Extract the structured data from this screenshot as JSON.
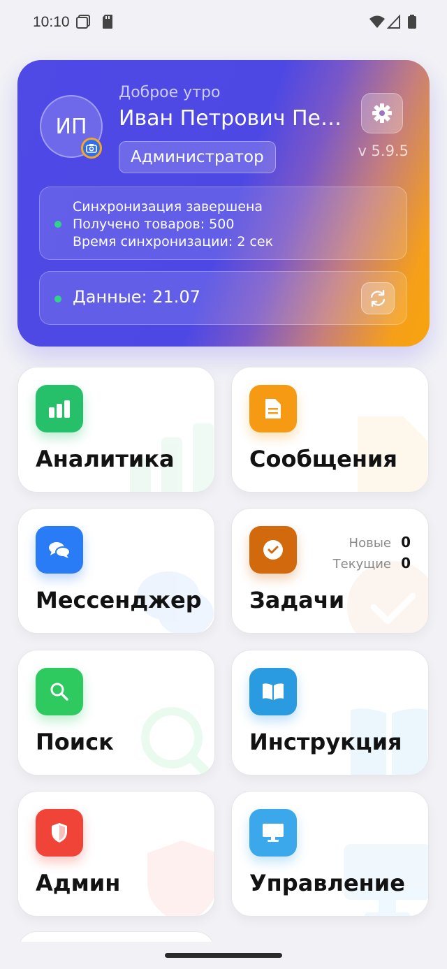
{
  "status_bar": {
    "time": "10:10"
  },
  "header": {
    "avatar_initials": "ИП",
    "greeting": "Доброе утро",
    "user_name": "Иван Петрович Пет...",
    "role": "Администратор",
    "version": "v 5.9.5",
    "sync": {
      "line1": "Синхронизация завершена",
      "line2": "Получено товаров: 500",
      "line3": "Время синхронизации: 2 сек"
    },
    "data_label": "Данные: 21.07"
  },
  "tiles": {
    "analytics": {
      "label": "Аналитика",
      "icon": "bar-chart-icon",
      "color": "#27c06a"
    },
    "messages": {
      "label": "Сообщения",
      "icon": "document-icon",
      "color": "#f59a12"
    },
    "messenger": {
      "label": "Мессенджер",
      "icon": "chat-bubbles-icon",
      "color": "#2a7cf6"
    },
    "tasks": {
      "label": "Задачи",
      "icon": "check-circle-icon",
      "color": "#d2690c",
      "new_label": "Новые",
      "new_count": "0",
      "current_label": "Текущие",
      "current_count": "0"
    },
    "search": {
      "label": "Поиск",
      "icon": "search-icon",
      "color": "#2fca5f"
    },
    "instructions": {
      "label": "Инструкция",
      "icon": "book-icon",
      "color": "#2a9be0"
    },
    "admin": {
      "label": "Админ",
      "icon": "shield-icon",
      "color": "#f04438"
    },
    "management": {
      "label": "Управление",
      "icon": "monitor-icon",
      "color": "#3aa8ea"
    }
  }
}
